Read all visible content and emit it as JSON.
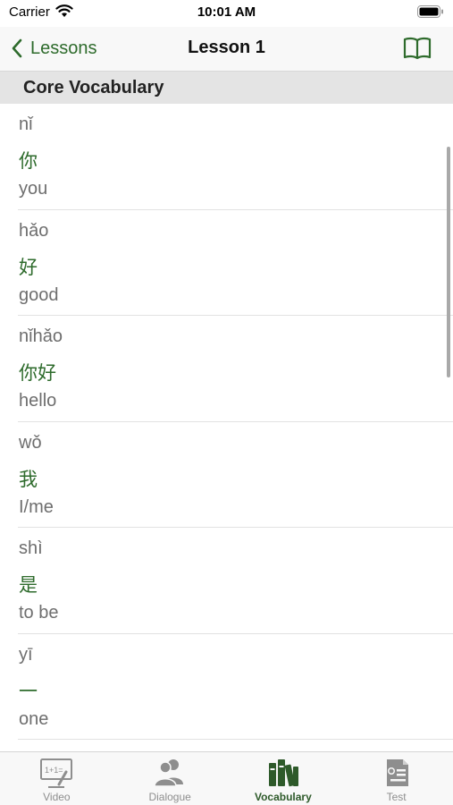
{
  "status_bar": {
    "carrier": "Carrier",
    "time": "10:01 AM"
  },
  "nav": {
    "back_label": "Lessons",
    "title": "Lesson 1"
  },
  "section": {
    "title": "Core Vocabulary"
  },
  "vocab": [
    {
      "pinyin": "nǐ",
      "hanzi": "你",
      "meaning": "you"
    },
    {
      "pinyin": "hǎo",
      "hanzi": "好",
      "meaning": "good"
    },
    {
      "pinyin": "nǐhǎo",
      "hanzi": "你好",
      "meaning": "hello"
    },
    {
      "pinyin": "wǒ",
      "hanzi": "我",
      "meaning": "I/me"
    },
    {
      "pinyin": "shì",
      "hanzi": "是",
      "meaning": "to be"
    },
    {
      "pinyin": "yī",
      "hanzi": "一",
      "meaning": "one"
    }
  ],
  "tabs": [
    {
      "label": "Video",
      "icon": "video-lesson-icon",
      "active": false
    },
    {
      "label": "Dialogue",
      "icon": "people-icon",
      "active": false
    },
    {
      "label": "Vocabulary",
      "icon": "books-icon",
      "active": true
    },
    {
      "label": "Test",
      "icon": "test-certificate-icon",
      "active": false
    }
  ],
  "colors": {
    "accent": "#2e6b2c",
    "inactive_tab": "#8e8e8e",
    "section_bg": "#e4e4e4"
  }
}
